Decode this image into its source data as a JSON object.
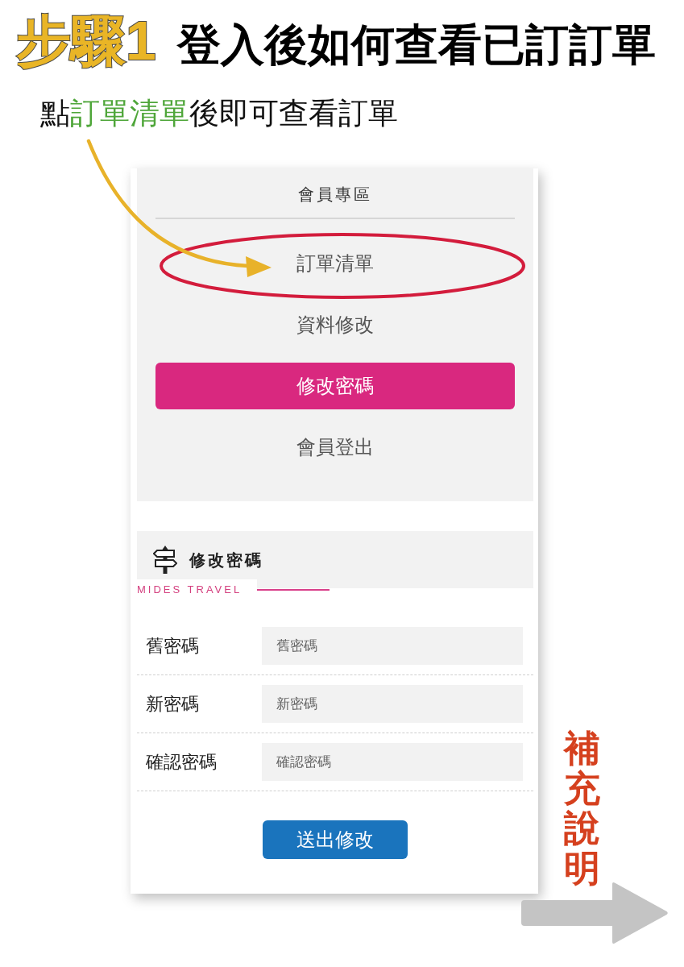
{
  "header": {
    "step": "步驟1",
    "title": "登入後如何查看已訂訂單"
  },
  "instruction": [
    {
      "text": "點",
      "highlight": false
    },
    {
      "text": "訂單清單",
      "highlight": true
    },
    {
      "text": "後即可查看訂單",
      "highlight": false
    }
  ],
  "member_menu": {
    "title": "會員專區",
    "items": [
      {
        "label": "訂單清單",
        "selected": false,
        "circled": true
      },
      {
        "label": "資料修改",
        "selected": false,
        "circled": false
      },
      {
        "label": "修改密碼",
        "selected": true,
        "circled": false
      },
      {
        "label": "會員登出",
        "selected": false,
        "circled": false
      }
    ]
  },
  "section": {
    "title": "修改密碼",
    "brand": "MIDES TRAVEL"
  },
  "form": {
    "fields": [
      {
        "label": "舊密碼",
        "placeholder": "舊密碼"
      },
      {
        "label": "新密碼",
        "placeholder": "新密碼"
      },
      {
        "label": "確認密碼",
        "placeholder": "確認密碼"
      }
    ],
    "submit": "送出修改"
  },
  "side_note": "補充說明"
}
